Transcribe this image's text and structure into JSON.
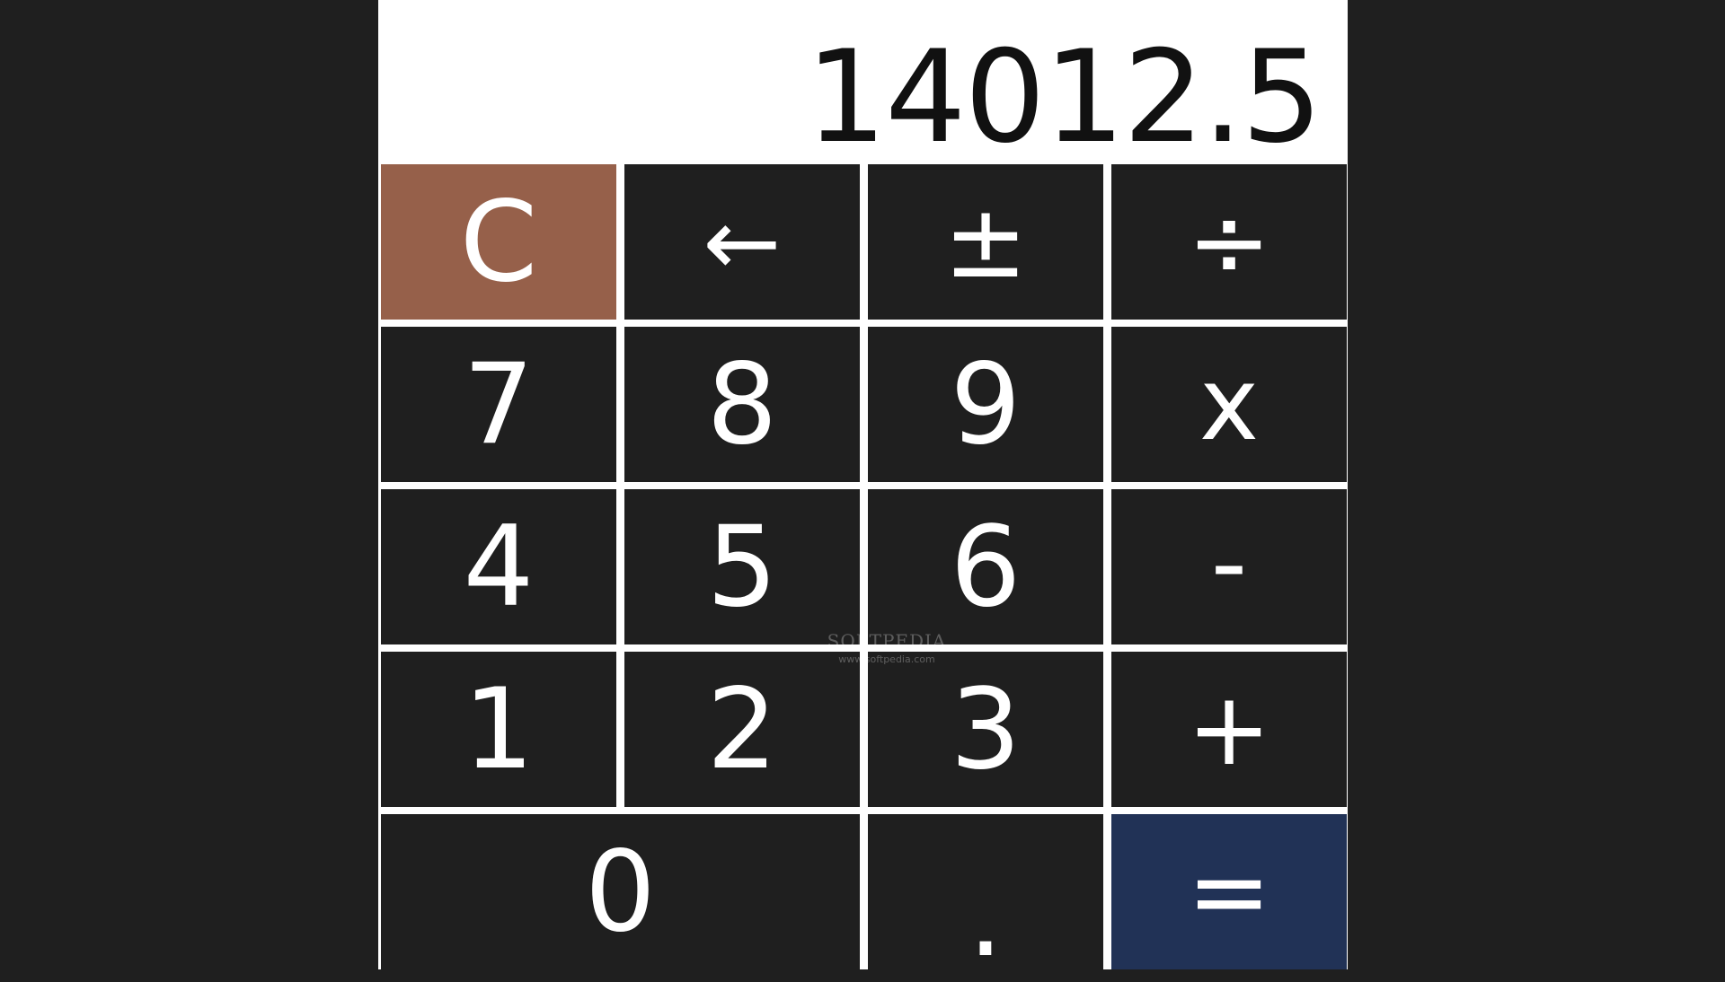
{
  "display": {
    "value": "14012.5"
  },
  "keys": {
    "clear": "C",
    "backspace": "←",
    "plus_minus": "±",
    "divide": "÷",
    "seven": "7",
    "eight": "8",
    "nine": "9",
    "multiply": "x",
    "four": "4",
    "five": "5",
    "six": "6",
    "subtract": "-",
    "one": "1",
    "two": "2",
    "three": "3",
    "add": "+",
    "zero": "0",
    "decimal": ".",
    "equals": "="
  },
  "watermark": {
    "brand": "SOFTPEDIA",
    "url": "www.softpedia.com"
  },
  "colors": {
    "background": "#1f1f1f",
    "key": "#1f1f1f",
    "clear_key": "#96604a",
    "equals_key": "#213256",
    "display_bg": "#ffffff",
    "display_text": "#111111"
  }
}
